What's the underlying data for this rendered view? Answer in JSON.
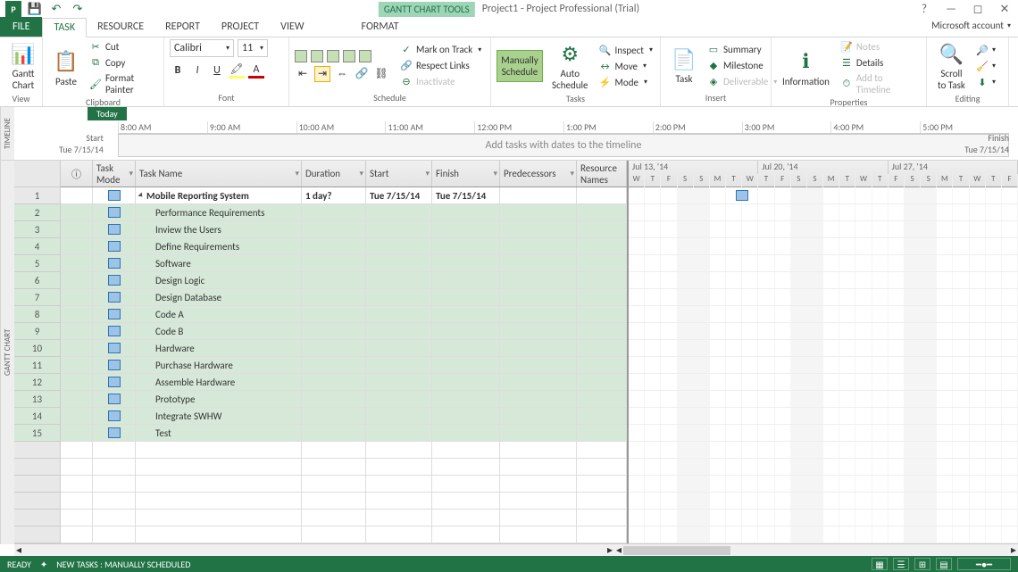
{
  "title": {
    "tool_tab": "GANTT CHART TOOLS",
    "app": "Project1 - Project Professional (Trial)"
  },
  "tabs": {
    "file": "FILE",
    "task": "TASK",
    "resource": "RESOURCE",
    "report": "REPORT",
    "project": "PROJECT",
    "view": "VIEW",
    "format": "FORMAT"
  },
  "account": "Microsoft account",
  "ribbon": {
    "view": {
      "gantt": "Gantt\nChart",
      "label": "View"
    },
    "clipboard": {
      "paste": "Paste",
      "cut": "Cut",
      "copy": "Copy",
      "fp": "Format Painter",
      "label": "Clipboard"
    },
    "font": {
      "name": "Calibri",
      "size": "11",
      "label": "Font"
    },
    "schedule": {
      "mark": "Mark on Track",
      "respect": "Respect Links",
      "inactivate": "Inactivate",
      "label": "Schedule"
    },
    "tasks": {
      "manual": "Manually\nSchedule",
      "auto": "Auto\nSchedule",
      "inspect": "Inspect",
      "move": "Move",
      "mode": "Mode",
      "label": "Tasks"
    },
    "insert": {
      "task": "Task",
      "summary": "Summary",
      "milestone": "Milestone",
      "deliverable": "Deliverable",
      "label": "Insert"
    },
    "props": {
      "info": "Information",
      "notes": "Notes",
      "details": "Details",
      "timeline": "Add to Timeline",
      "label": "Properties"
    },
    "editing": {
      "scroll": "Scroll\nto Task",
      "label": "Editing"
    }
  },
  "timeline": {
    "today": "Today",
    "start_label": "Start",
    "start_date": "Tue 7/15/14",
    "finish_label": "Finish",
    "finish_date": "Tue 7/15/14",
    "hint": "Add tasks with dates to the timeline",
    "ticks": [
      "8:00 AM",
      "9:00 AM",
      "10:00 AM",
      "11:00 AM",
      "12:00 PM",
      "1:00 PM",
      "2:00 PM",
      "3:00 PM",
      "4:00 PM",
      "5:00 PM"
    ]
  },
  "columns": {
    "info": "",
    "mode": "Task Mode",
    "name": "Task Name",
    "dur": "Duration",
    "start": "Start",
    "finish": "Finish",
    "pred": "Predecessors",
    "res": "Resource Names"
  },
  "tasks": [
    {
      "n": "1",
      "name": "Mobile Reporting System",
      "dur": "1 day?",
      "start": "Tue 7/15/14",
      "finish": "Tue 7/15/14",
      "bold": true,
      "ind": 0
    },
    {
      "n": "2",
      "name": "Performance Requirements",
      "ind": 1
    },
    {
      "n": "3",
      "name": "Inview the Users",
      "ind": 1
    },
    {
      "n": "4",
      "name": "Define Requirements",
      "ind": 1
    },
    {
      "n": "5",
      "name": "Software",
      "ind": 1
    },
    {
      "n": "6",
      "name": "Design Logic",
      "ind": 1
    },
    {
      "n": "7",
      "name": "Design Database",
      "ind": 1
    },
    {
      "n": "8",
      "name": "Code A",
      "ind": 1
    },
    {
      "n": "9",
      "name": "Code B",
      "ind": 1
    },
    {
      "n": "10",
      "name": "Hardware",
      "ind": 1
    },
    {
      "n": "11",
      "name": "Purchase Hardware",
      "ind": 1
    },
    {
      "n": "12",
      "name": "Assemble Hardware",
      "ind": 1
    },
    {
      "n": "13",
      "name": "Prototype",
      "ind": 1
    },
    {
      "n": "14",
      "name": "Integrate SWHW",
      "ind": 1
    },
    {
      "n": "15",
      "name": "Test",
      "ind": 1
    }
  ],
  "gantt": {
    "weeks": [
      "Jul 13, '14",
      "Jul 20, '14",
      "Jul 27, '14"
    ],
    "days": [
      "W",
      "T",
      "F",
      "S",
      "S",
      "M",
      "T",
      "W",
      "T",
      "F",
      "S",
      "S",
      "M",
      "T",
      "W",
      "T",
      "F",
      "S",
      "S",
      "M",
      "T",
      "W",
      "T",
      "F"
    ]
  },
  "status": {
    "ready": "READY",
    "mode": "NEW TASKS : MANUALLY SCHEDULED"
  },
  "vtabs": {
    "timeline": "TIMELINE",
    "gantt": "GANTT CHART"
  }
}
